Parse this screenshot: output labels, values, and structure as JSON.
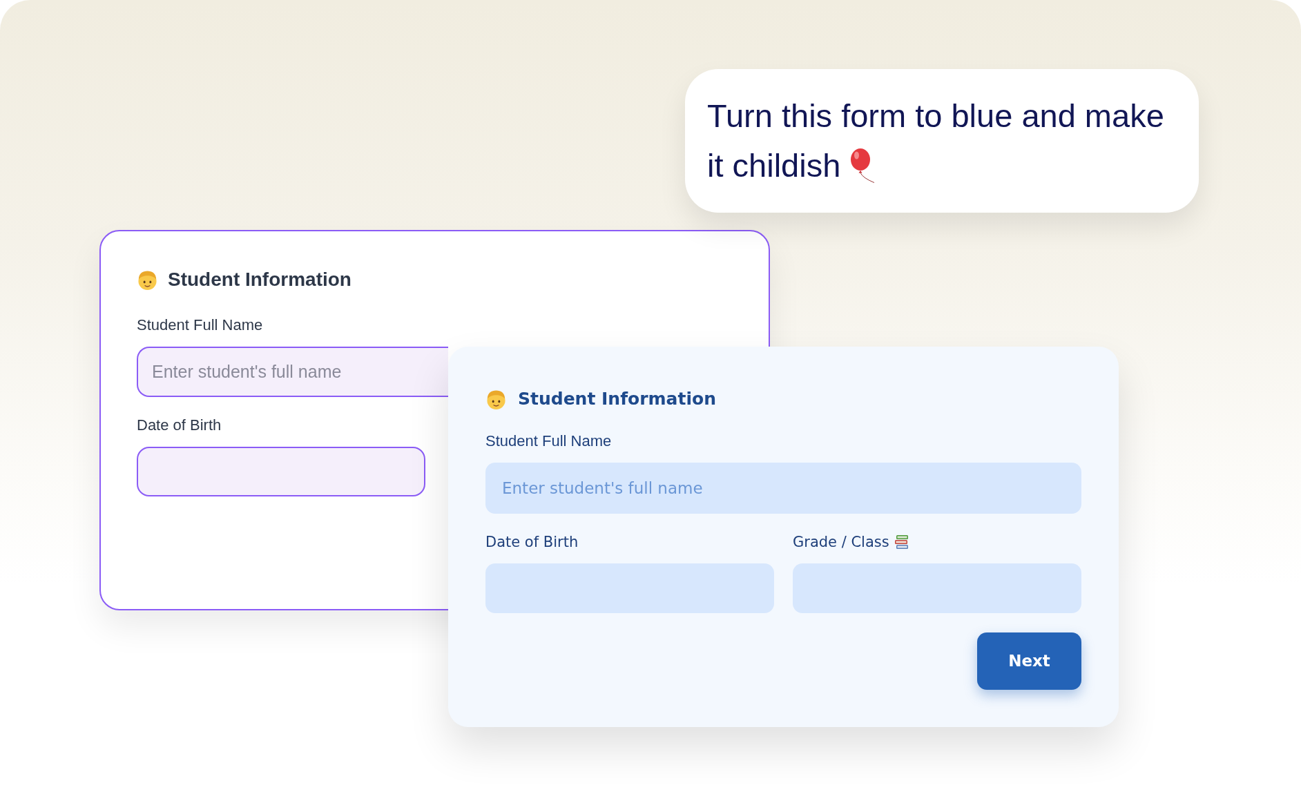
{
  "prompt": {
    "lines": [
      "Turn this form to blue and make",
      "it childish"
    ]
  },
  "forms": [
    {
      "kind": "plain",
      "title": "Student Information",
      "fields": [
        {
          "kind": "full",
          "label": "Student Full Name",
          "placeholder": "Enter student's full name"
        },
        {
          "kind": "half",
          "label": "Date of Birth"
        }
      ]
    },
    {
      "kind": "playful",
      "title": "Student Information",
      "fields": [
        {
          "kind": "full",
          "label": "Student Full Name",
          "placeholder": "Enter student's full name"
        },
        {
          "kind": "half",
          "label": "Date of Birth"
        },
        {
          "kind": "half",
          "label": "Grade / Class"
        }
      ],
      "button": "Next"
    }
  ]
}
